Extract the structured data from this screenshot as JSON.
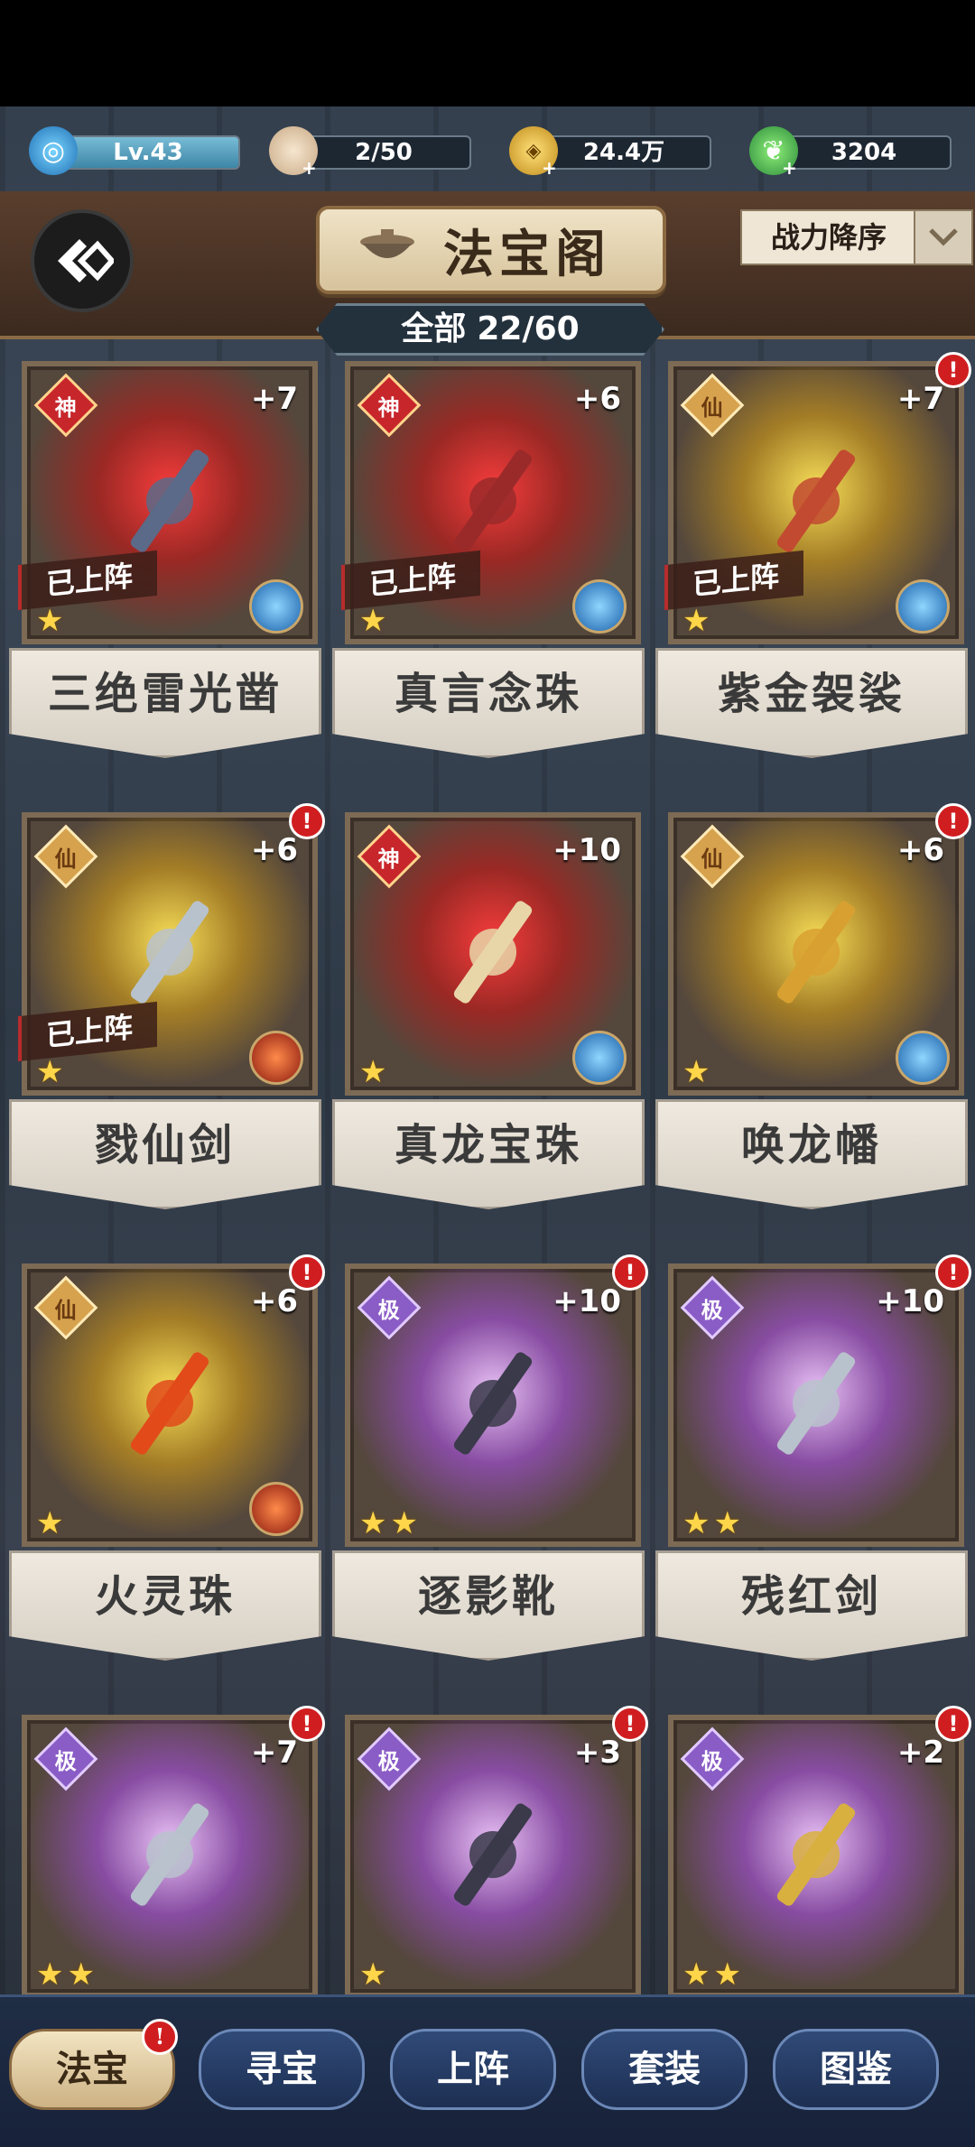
{
  "resources": {
    "level": "Lv.43",
    "stamina": "2/50",
    "coins": "24.4万",
    "jade": "3204"
  },
  "header": {
    "title": "法宝阁",
    "sort_label": "战力降序"
  },
  "inventory": {
    "filter_label": "全部",
    "count": "22/60"
  },
  "labels": {
    "equipped": "已上阵"
  },
  "items": [
    {
      "name": "三绝雷光凿",
      "tier": "神",
      "level": "+7",
      "stars": 1,
      "equipped": true,
      "alert": false
    },
    {
      "name": "真言念珠",
      "tier": "神",
      "level": "+6",
      "stars": 1,
      "equipped": true,
      "alert": false
    },
    {
      "name": "紫金袈裟",
      "tier": "仙",
      "level": "+7",
      "stars": 1,
      "equipped": true,
      "alert": true
    },
    {
      "name": "戮仙剑",
      "tier": "仙",
      "level": "+6",
      "stars": 1,
      "equipped": true,
      "alert": true
    },
    {
      "name": "真龙宝珠",
      "tier": "神",
      "level": "+10",
      "stars": 1,
      "equipped": false,
      "alert": false
    },
    {
      "name": "唤龙幡",
      "tier": "仙",
      "level": "+6",
      "stars": 1,
      "equipped": false,
      "alert": true
    },
    {
      "name": "火灵珠",
      "tier": "仙",
      "level": "+6",
      "stars": 1,
      "equipped": false,
      "alert": true
    },
    {
      "name": "逐影靴",
      "tier": "极",
      "level": "+10",
      "stars": 2,
      "equipped": false,
      "alert": true
    },
    {
      "name": "残红剑",
      "tier": "极",
      "level": "+10",
      "stars": 2,
      "equipped": false,
      "alert": true
    },
    {
      "name": "",
      "tier": "极",
      "level": "+7",
      "stars": 2,
      "equipped": false,
      "alert": true
    },
    {
      "name": "",
      "tier": "极",
      "level": "+3",
      "stars": 1,
      "equipped": false,
      "alert": true
    },
    {
      "name": "",
      "tier": "极",
      "level": "+2",
      "stars": 2,
      "equipped": false,
      "alert": true
    }
  ],
  "tabs": [
    {
      "label": "法宝",
      "active": true,
      "alert": true
    },
    {
      "label": "寻宝",
      "active": false,
      "alert": false
    },
    {
      "label": "上阵",
      "active": false,
      "alert": false
    },
    {
      "label": "套装",
      "active": false,
      "alert": false
    },
    {
      "label": "图鉴",
      "active": false,
      "alert": false
    }
  ],
  "alert_mark": "!",
  "star_glyph": "★",
  "colors": {
    "tier_shen": "#c7262b",
    "tier_xian": "#d6a24e",
    "tier_ji": "#8a5cc6",
    "alert": "#d01e20",
    "star": "#ffd54a"
  }
}
